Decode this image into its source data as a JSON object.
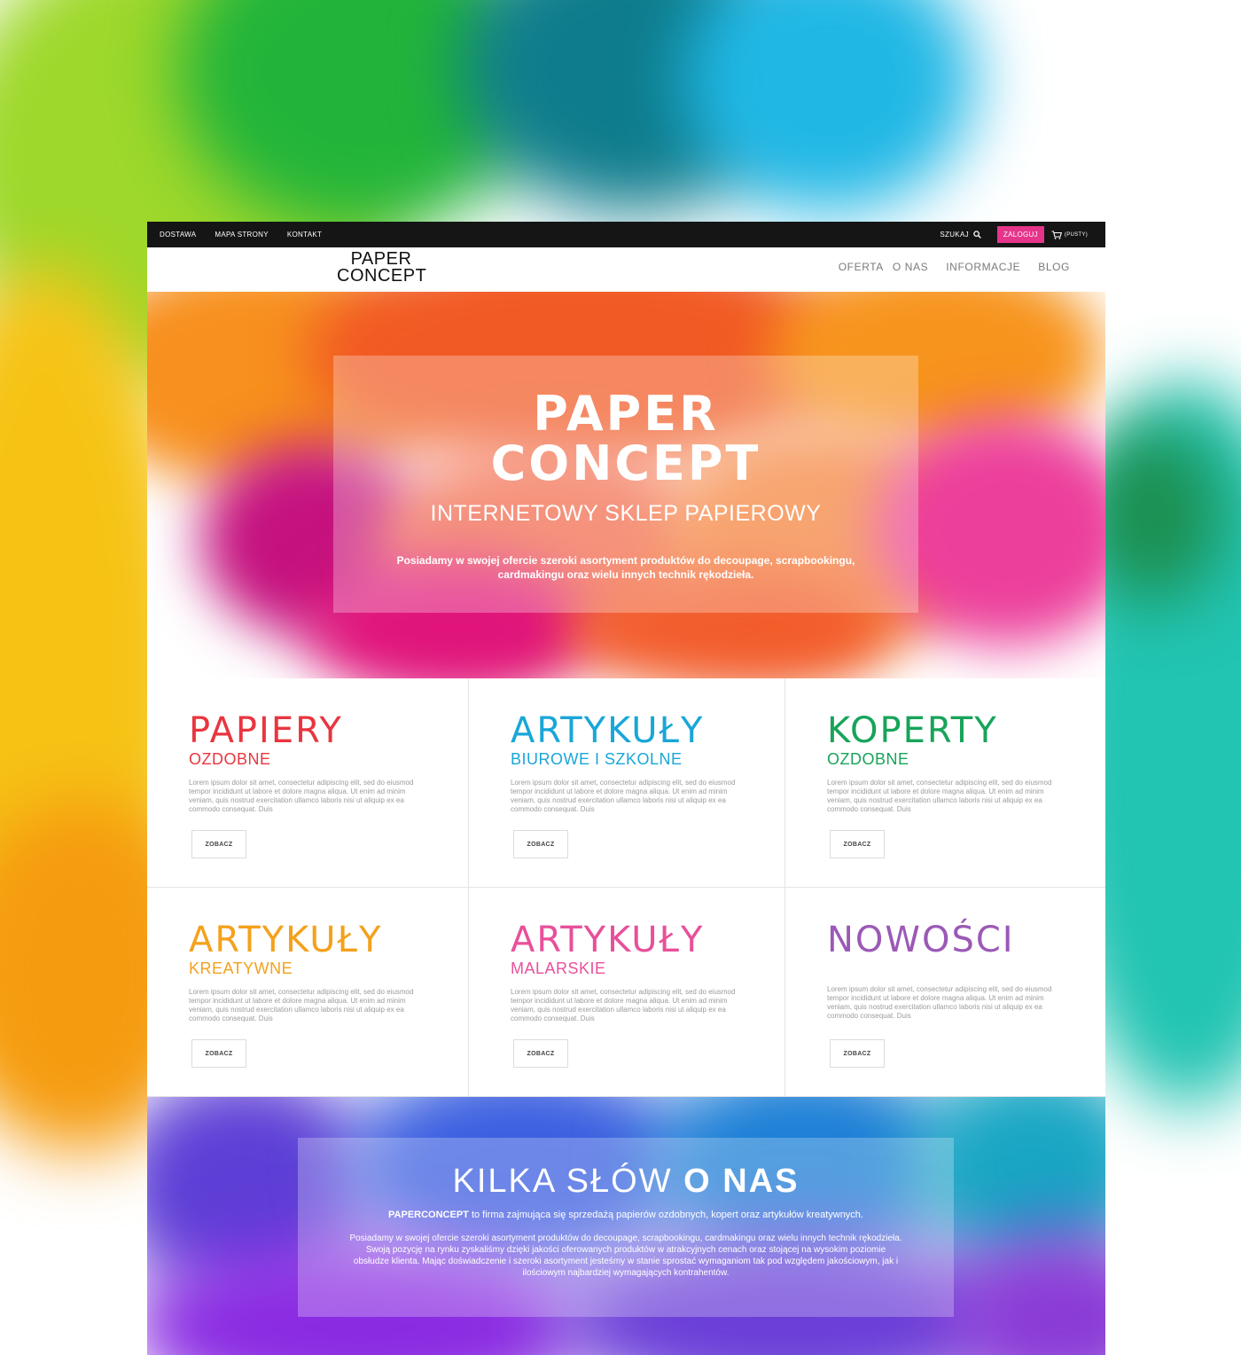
{
  "topbar": {
    "links": [
      "DOSTAWA",
      "MAPA STRONY",
      "KONTAKT"
    ],
    "search_label": "SZUKAJ",
    "login_label": "ZALOGUJ",
    "cart_label": "(PUSTY)"
  },
  "logo": {
    "line1": "PAPER",
    "line2": "CONCEPT"
  },
  "nav": [
    "OFERTA",
    "O NAS",
    "INFORMACJE",
    "BLOG"
  ],
  "hero": {
    "title_line1": "PAPER",
    "title_line2": "CONCEPT",
    "subtitle": "INTERNETOWY SKLEP PAPIEROWY",
    "description": "Posiadamy w swojej ofercie szeroki asortyment produktów do decoupage, scrapbookingu, cardmakingu oraz wielu innych technik rękodzieła."
  },
  "categories": [
    {
      "title": "PAPIERY",
      "subtitle": "OZDOBNE",
      "color": "#e8363f",
      "text": "Lorem ipsum dolor sit amet, consectetur adipiscing elit, sed do eiusmod tempor incididunt ut labore et dolore magna aliqua. Ut enim ad minim veniam, quis nostrud exercitation ullamco laboris nisi ut aliquip ex ea commodo consequat. Duis",
      "button": "ZOBACZ"
    },
    {
      "title": "ARTYKUŁY",
      "subtitle": "BIUROWE I SZKOLNE",
      "color": "#1aa6d8",
      "text": "Lorem ipsum dolor sit amet, consectetur adipiscing elit, sed do eiusmod tempor incididunt ut labore et dolore magna aliqua. Ut enim ad minim veniam, quis nostrud exercitation ullamco laboris nisi ut aliquip ex ea commodo consequat. Duis",
      "button": "ZOBACZ"
    },
    {
      "title": "KOPERTY",
      "subtitle": "OZDOBNE",
      "color": "#17a45a",
      "text": "Lorem ipsum dolor sit amet, consectetur adipiscing elit, sed do eiusmod tempor incididunt ut labore et dolore magna aliqua. Ut enim ad minim veniam, quis nostrud exercitation ullamco laboris nisi ut aliquip ex ea commodo consequat. Duis",
      "button": "ZOBACZ"
    },
    {
      "title": "ARTYKUŁY",
      "subtitle": "KREATYWNE",
      "color": "#f4a11c",
      "text": "Lorem ipsum dolor sit amet, consectetur adipiscing elit, sed do eiusmod tempor incididunt ut labore et dolore magna aliqua. Ut enim ad minim veniam, quis nostrud exercitation ullamco laboris nisi ut aliquip ex ea commodo consequat. Duis",
      "button": "ZOBACZ"
    },
    {
      "title": "ARTYKUŁY",
      "subtitle": "MALARSKIE",
      "color": "#e8509a",
      "text": "Lorem ipsum dolor sit amet, consectetur adipiscing elit, sed do eiusmod tempor incididunt ut labore et dolore magna aliqua. Ut enim ad minim veniam, quis nostrud exercitation ullamco laboris nisi ut aliquip ex ea commodo consequat. Duis",
      "button": "ZOBACZ"
    },
    {
      "title": "NOWOŚCI",
      "subtitle": "",
      "color": "#9b59b6",
      "text": "Lorem ipsum dolor sit amet, consectetur adipiscing elit, sed do eiusmod tempor incididunt ut labore et dolore magna aliqua. Ut enim ad minim veniam, quis nostrud exercitation ullamco laboris nisi ut aliquip ex ea commodo consequat. Duis",
      "button": "ZOBACZ"
    }
  ],
  "about": {
    "title_light": "KILKA SŁÓW",
    "title_bold": "O NAS",
    "lead_bold": "PAPERCONCEPT",
    "lead_rest": " to firma zajmująca się sprzedażą papierów ozdobnych, kopert oraz artykułów kreatywnych.",
    "text": "Posiadamy w swojej ofercie szeroki asortyment produktów do decoupage, scrapbookingu, cardmakingu oraz wielu innych technik rękodzieła. Swoją pozycję na rynku zyskaliśmy dzięki jakości oferowanych produktów w atrakcyjnych cenach oraz stojącej na wysokim poziomie obsłudze klienta. Mając doświadczenie i szeroki asortyment jesteśmy w stanie sprostać wymaganiom tak pod względem jakościowym, jak i ilościowym najbardziej wymagających kontrahentów."
  },
  "colors": {
    "accent": "#e5348a",
    "topbar": "#151515"
  }
}
